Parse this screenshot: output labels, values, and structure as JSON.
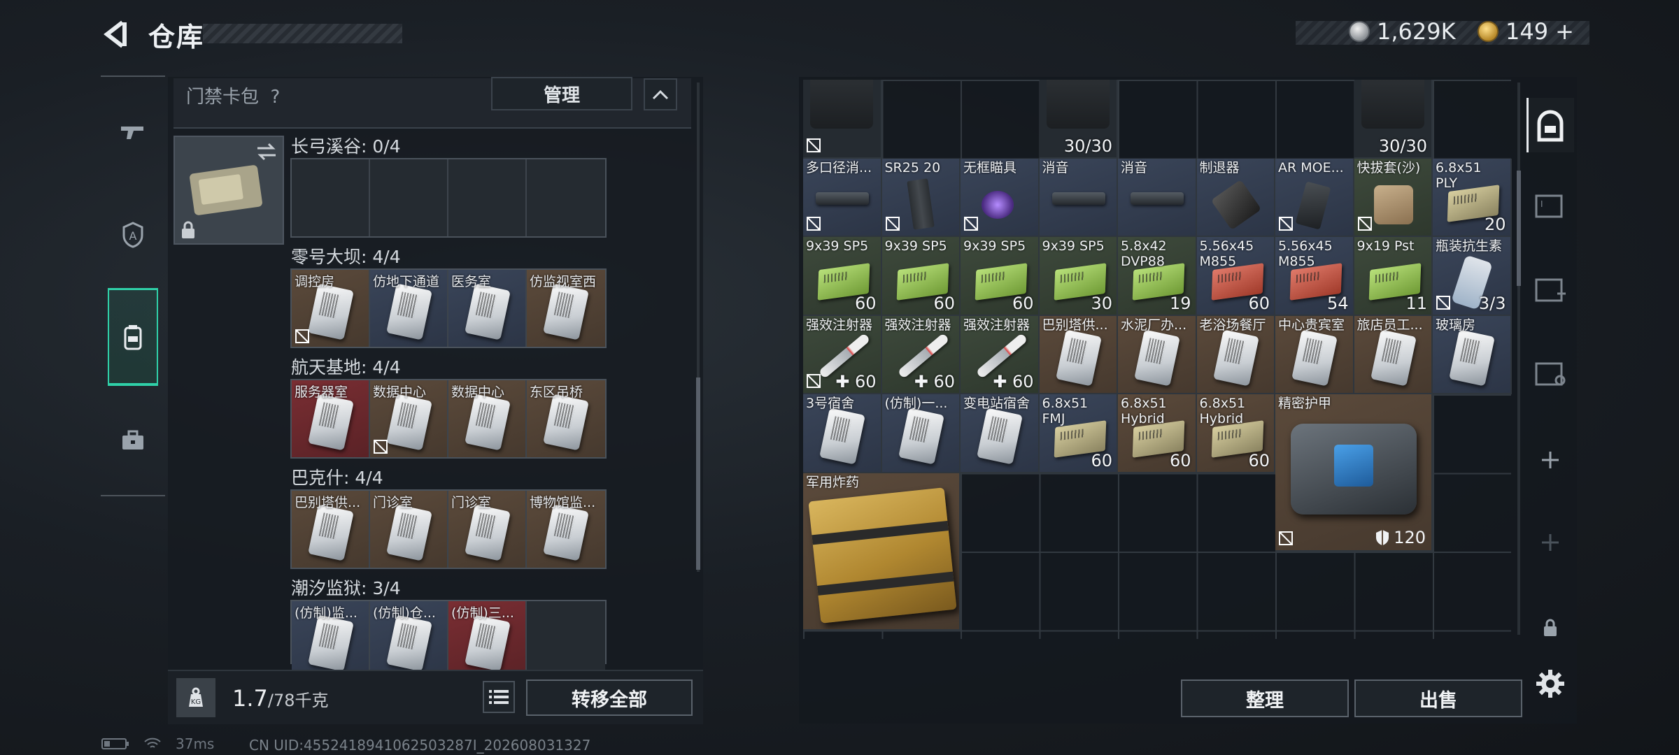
{
  "header": {
    "title": "仓库",
    "currency_silver": "1,629K",
    "currency_gold": "149",
    "gold_plus": "+"
  },
  "left_nav": {
    "items": [
      {
        "icon": "gun-icon"
      },
      {
        "icon": "operator-icon"
      },
      {
        "icon": "backpack-icon",
        "active": true
      },
      {
        "icon": "briefcase-icon"
      }
    ]
  },
  "keycard_panel": {
    "title": "门禁卡包",
    "help": "?",
    "manage_label": "管理",
    "groups": [
      {
        "title": "长弓溪谷: 0/4",
        "slots": [
          {
            "label": "",
            "bg": "dark",
            "card": false
          },
          {
            "label": "",
            "bg": "dark",
            "card": false
          },
          {
            "label": "",
            "bg": "dark",
            "card": false
          },
          {
            "label": "",
            "bg": "dark",
            "card": false
          }
        ]
      },
      {
        "title": "零号大坝: 4/4",
        "slots": [
          {
            "label": "调控房",
            "bg": "brown",
            "card": true,
            "nolock": true
          },
          {
            "label": "仿地下通道",
            "bg": "blue",
            "card": true
          },
          {
            "label": "医务室",
            "bg": "blue",
            "card": true
          },
          {
            "label": "仿监视室西",
            "bg": "brown",
            "card": true
          }
        ]
      },
      {
        "title": "航天基地: 4/4",
        "slots": [
          {
            "label": "服务器室",
            "bg": "red",
            "card": true
          },
          {
            "label": "数据中心",
            "bg": "brown",
            "card": true,
            "nolock": true
          },
          {
            "label": "数据中心",
            "bg": "brown",
            "card": true
          },
          {
            "label": "东区吊桥",
            "bg": "brown",
            "card": true
          }
        ]
      },
      {
        "title": "巴克什: 4/4",
        "slots": [
          {
            "label": "巴别塔供...",
            "bg": "brown",
            "card": true
          },
          {
            "label": "门诊室",
            "bg": "brown",
            "card": true
          },
          {
            "label": "门诊室",
            "bg": "brown",
            "card": true
          },
          {
            "label": "博物馆监...",
            "bg": "brown",
            "card": true
          }
        ]
      },
      {
        "title": "潮汐监狱: 3/4",
        "slots": [
          {
            "label": "(仿制)监...",
            "bg": "blue",
            "card": true
          },
          {
            "label": "(仿制)仓...",
            "bg": "blue",
            "card": true
          },
          {
            "label": "(仿制)三...",
            "bg": "red",
            "card": true
          },
          {
            "label": "",
            "bg": "dark",
            "card": false
          }
        ]
      }
    ]
  },
  "weight": {
    "current": "1.7",
    "max": "/78千克",
    "kg_label": "KG"
  },
  "transfer_all_label": "转移全部",
  "storage": {
    "items": [
      {
        "name": "",
        "count": "",
        "kind": "weapon",
        "bg": "dark",
        "nolock": true,
        "col": 1,
        "row": 1,
        "w": 1,
        "h": 1
      },
      {
        "name": "",
        "count": "30/30",
        "kind": "weapon",
        "bg": "dark",
        "col": 4,
        "row": 1,
        "w": 1,
        "h": 1
      },
      {
        "name": "",
        "count": "30/30",
        "kind": "weapon",
        "bg": "dark",
        "col": 8,
        "row": 1,
        "w": 1,
        "h": 1
      },
      {
        "name": "多口径消...",
        "count": "",
        "kind": "attach",
        "bg": "blue",
        "nolock": true
      },
      {
        "name": "SR25 20",
        "count": "",
        "kind": "mag",
        "bg": "blue",
        "nolock": true
      },
      {
        "name": "无框瞄具",
        "count": "",
        "kind": "scope",
        "bg": "blue",
        "nolock": true
      },
      {
        "name": "消音",
        "count": "",
        "kind": "attach",
        "bg": "blue"
      },
      {
        "name": "消音",
        "count": "",
        "kind": "attach",
        "bg": "blue"
      },
      {
        "name": "制退器",
        "count": "",
        "kind": "brake",
        "bg": "blue"
      },
      {
        "name": "AR MOE...",
        "count": "",
        "kind": "grip",
        "bg": "blue",
        "nolock": true
      },
      {
        "name": "快拔套(沙)",
        "count": "",
        "kind": "holster",
        "bg": "green",
        "nolock": true
      },
      {
        "name": "6.8x51 PLY",
        "count": "20",
        "kind": "ammo-tan",
        "bg": "blue"
      },
      {
        "name": "9x39 SP5",
        "count": "60",
        "kind": "ammo",
        "bg": "green"
      },
      {
        "name": "9x39 SP5",
        "count": "60",
        "kind": "ammo",
        "bg": "green"
      },
      {
        "name": "9x39 SP5",
        "count": "60",
        "kind": "ammo",
        "bg": "green"
      },
      {
        "name": "9x39 SP5",
        "count": "30",
        "kind": "ammo",
        "bg": "green"
      },
      {
        "name": "5.8x42 DVP88",
        "count": "19",
        "kind": "ammo",
        "bg": "green"
      },
      {
        "name": "5.56x45 M855",
        "count": "60",
        "kind": "ammo-red",
        "bg": "blue"
      },
      {
        "name": "5.56x45 M855",
        "count": "54",
        "kind": "ammo-red",
        "bg": "blue"
      },
      {
        "name": "9x19 Pst",
        "count": "11",
        "kind": "ammo",
        "bg": "green"
      },
      {
        "name": "瓶装抗生素",
        "count": "3/3",
        "kind": "pills",
        "bg": "blue",
        "nolock": true
      },
      {
        "name": "强效注射器",
        "count": "✚ 60",
        "kind": "syringe",
        "bg": "green",
        "nolock": true
      },
      {
        "name": "强效注射器",
        "count": "✚ 60",
        "kind": "syringe",
        "bg": "green"
      },
      {
        "name": "强效注射器",
        "count": "✚ 60",
        "kind": "syringe",
        "bg": "green"
      },
      {
        "name": "巴别塔供...",
        "count": "",
        "kind": "card",
        "bg": "brown"
      },
      {
        "name": "水泥厂办...",
        "count": "",
        "kind": "card",
        "bg": "brown"
      },
      {
        "name": "老浴场餐厅",
        "count": "",
        "kind": "card",
        "bg": "brown"
      },
      {
        "name": "中心贵宾室",
        "count": "",
        "kind": "card",
        "bg": "brown"
      },
      {
        "name": "旅店员工...",
        "count": "",
        "kind": "card",
        "bg": "brown"
      },
      {
        "name": "玻璃房",
        "count": "",
        "kind": "card",
        "bg": "blue"
      },
      {
        "name": "3号宿舍",
        "count": "",
        "kind": "card",
        "bg": "blue"
      },
      {
        "name": "(仿制)一...",
        "count": "",
        "kind": "card",
        "bg": "blue"
      },
      {
        "name": "变电站宿舍",
        "count": "",
        "kind": "card",
        "bg": "blue"
      },
      {
        "name": "6.8x51 FMJ",
        "count": "60",
        "kind": "ammo-tan",
        "bg": "blue"
      },
      {
        "name": "6.8x51 Hybrid",
        "count": "60",
        "kind": "ammo-tan",
        "bg": "brown"
      },
      {
        "name": "6.8x51 Hybrid",
        "count": "60",
        "kind": "ammo-tan",
        "bg": "brown"
      },
      {
        "name": "精密护甲",
        "count": "120",
        "kind": "armor",
        "bg": "brown",
        "nolock": true,
        "w": 2,
        "h": 2
      },
      {
        "name": "军用炸药",
        "count": "",
        "kind": "bigbox",
        "bg": "brown",
        "w": 2,
        "h": 2
      }
    ]
  },
  "sort_label": "整理",
  "sell_label": "出售",
  "right_nav": {
    "items": [
      "bag-icon",
      "storage-icon",
      "storage-add-icon",
      "storage-settings-icon",
      "plus-icon",
      "plus-icon-disabled",
      "lock-icon"
    ]
  },
  "status": {
    "ping": "37ms",
    "uid": "CN UID:4552418941062503287I_202608031327"
  },
  "colors": {
    "accent": "#2fd0a8",
    "panel": "#161b21"
  }
}
